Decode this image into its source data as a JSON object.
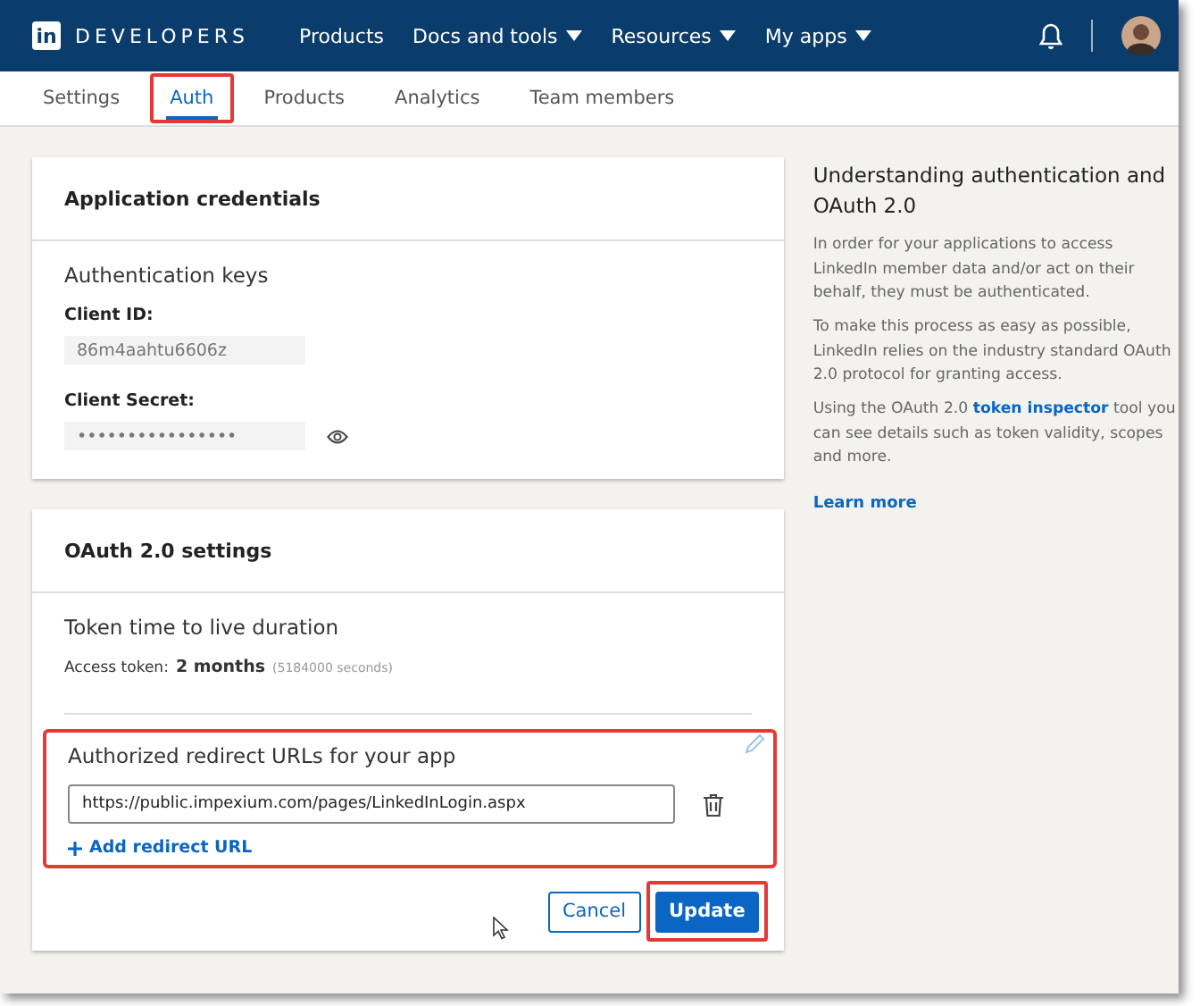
{
  "navbar": {
    "logo_mark": "in",
    "brand": "DEVELOPERS",
    "menu": [
      {
        "label": "Products",
        "dropdown": false
      },
      {
        "label": "Docs and tools",
        "dropdown": true
      },
      {
        "label": "Resources",
        "dropdown": true
      },
      {
        "label": "My apps",
        "dropdown": true
      }
    ]
  },
  "tabs": [
    {
      "label": "Settings",
      "selected": false,
      "highlighted": false
    },
    {
      "label": "Auth",
      "selected": true,
      "highlighted": true
    },
    {
      "label": "Products",
      "selected": false,
      "highlighted": false
    },
    {
      "label": "Analytics",
      "selected": false,
      "highlighted": false
    },
    {
      "label": "Team members",
      "selected": false,
      "highlighted": false
    }
  ],
  "credentials": {
    "title": "Application credentials",
    "subtitle": "Authentication keys",
    "client_id_label": "Client ID:",
    "client_id": "86m4aahtu6606z",
    "client_secret_label": "Client Secret:",
    "client_secret": "••••••••••••••••"
  },
  "oauth": {
    "title": "OAuth 2.0 settings",
    "subtitle": "Token time to live duration",
    "access_label": "Access token:",
    "access_value": "2 months",
    "access_seconds": "(5184000 seconds)",
    "redirect": {
      "title": "Authorized redirect URLs for your app",
      "highlighted": true,
      "urls": [
        "https://public.impexium.com/pages/LinkedInLogin.aspx"
      ],
      "add_label": "Add redirect URL"
    },
    "buttons": [
      {
        "label": "Cancel",
        "kind": "secondary",
        "highlighted": false
      },
      {
        "label": "Update",
        "kind": "primary",
        "highlighted": true
      }
    ]
  },
  "sidebar": {
    "title": "Understanding authentication and OAuth 2.0",
    "paragraphs": [
      "In order for your applications to access LinkedIn member data and/or act on their behalf, they must be authenticated.",
      "To make this process as easy as possible, LinkedIn relies on the industry standard OAuth 2.0 protocol for granting access."
    ],
    "inspector": {
      "before": "Using the OAuth 2.0 ",
      "link": "token inspector",
      "after": " tool you can see details such as token validity, scopes and more."
    },
    "learn_more": "Learn more"
  }
}
